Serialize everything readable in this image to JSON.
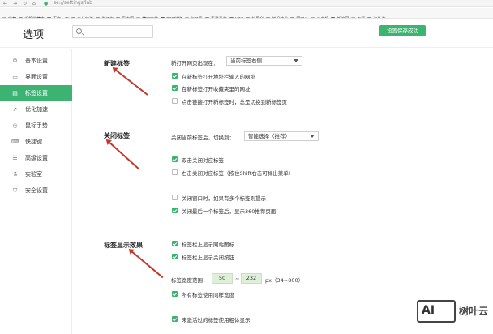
{
  "browser": {
    "url": "se://settings/lab",
    "bookmarks": [
      "收藏",
      "手机收藏夹",
      "百度一下",
      "三分钟游",
      "你还在",
      "贝次网",
      "藏宝库站",
      "PDF转换",
      "每日看",
      "喜爱看的",
      "H3C",
      "松果利",
      "前沿技术",
      "国家公",
      "云主机",
      "新浪网",
      "天籁",
      "海外游"
    ]
  },
  "header": {
    "title": "选项",
    "search_placeholder": "",
    "saved_notice": "设置保存成功"
  },
  "sidebar": {
    "items": [
      {
        "label": "基本设置",
        "icon": "gear-icon"
      },
      {
        "label": "界面设置",
        "icon": "window-icon"
      },
      {
        "label": "标签设置",
        "icon": "tab-icon"
      },
      {
        "label": "优化加速",
        "icon": "rocket-icon"
      },
      {
        "label": "鼠标手势",
        "icon": "mouse-icon"
      },
      {
        "label": "快捷键",
        "icon": "keyboard-icon"
      },
      {
        "label": "高级设置",
        "icon": "settings-icon"
      },
      {
        "label": "实验室",
        "icon": "lab-icon"
      },
      {
        "label": "安全设置",
        "icon": "shield-icon"
      }
    ],
    "active_index": 2
  },
  "new_tab": {
    "title": "新建标签",
    "open_label": "新打开网页出现在：",
    "open_value": "当前标签右侧",
    "options": [
      {
        "label": "在新标签打开地址栏输入的网址",
        "checked": true
      },
      {
        "label": "在新标签打开收藏夹里的网址",
        "checked": true
      },
      {
        "label": "点击链接打开新标签时，总是切换到新标签页",
        "checked": false
      }
    ]
  },
  "close_tab": {
    "title": "关闭标签",
    "switch_label": "关闭当前标签后，切换到：",
    "switch_value": "智能选择（推荐）",
    "options": [
      {
        "label": "双击关闭对应标签",
        "checked": true
      },
      {
        "label": "右击关闭对应标签（按住Shift右击可弹出菜单）",
        "checked": false
      },
      {
        "label": "关闭窗口时，如果有多个标签则提示",
        "checked": false
      },
      {
        "label": "关闭最后一个标签后，显示360推荐页面",
        "checked": true
      }
    ]
  },
  "tab_display": {
    "title": "标签显示效果",
    "options": [
      {
        "label": "标签栏上显示网站图标",
        "checked": true
      },
      {
        "label": "标签栏上显示关闭按钮",
        "checked": true
      }
    ],
    "width_label": "标签宽度范围：",
    "width_min": "50",
    "width_sep": "~",
    "width_max": "232",
    "width_unit": "px（34~800）",
    "same_width": {
      "label": "所有标签使用同样宽度",
      "checked": true
    },
    "unactivated": {
      "label": "未激活过的标签使用粗体显示",
      "checked": true
    }
  },
  "watermark": {
    "logo": "AI",
    "text": "树叶云"
  },
  "colors": {
    "accent": "#3cb371",
    "arrow": "#c0392b"
  }
}
